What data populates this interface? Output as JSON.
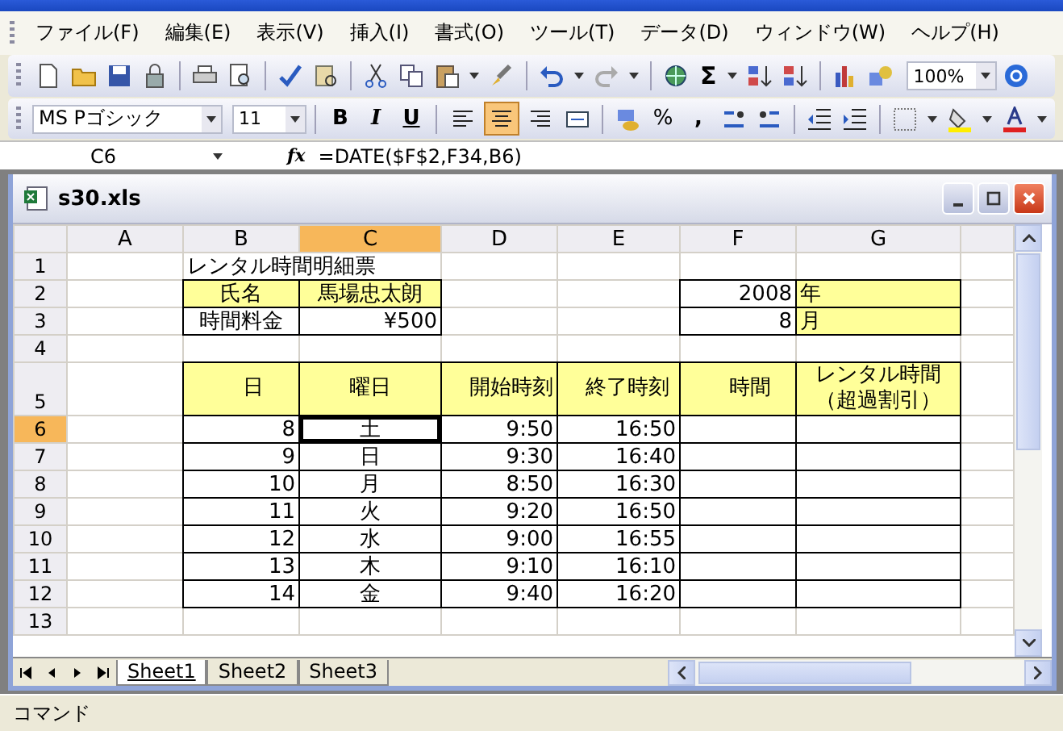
{
  "menu": [
    "ファイル(F)",
    "編集(E)",
    "表示(V)",
    "挿入(I)",
    "書式(O)",
    "ツール(T)",
    "データ(D)",
    "ウィンドウ(W)",
    "ヘルプ(H)"
  ],
  "standard_toolbar": {
    "sum_symbol": "Σ",
    "zoom": "100%"
  },
  "formatting_toolbar": {
    "font_name": "MS Pゴシック",
    "font_size": "11",
    "bold": "B",
    "italic": "I",
    "underline": "U",
    "alignment_buttons": [
      {
        "pressed": false
      },
      {
        "pressed": true
      },
      {
        "pressed": false
      }
    ],
    "percent": "%",
    "comma": ","
  },
  "formula_bar": {
    "name_box": "C6",
    "fx": "fx",
    "formula": "=DATE($F$2,F34,B6)"
  },
  "workbook": {
    "title": "s30.xls",
    "columns": [
      {
        "label": "A",
        "selected": false
      },
      {
        "label": "B",
        "selected": false
      },
      {
        "label": "C",
        "selected": true
      },
      {
        "label": "D",
        "selected": false
      },
      {
        "label": "E",
        "selected": false
      },
      {
        "label": "F",
        "selected": false
      },
      {
        "label": "G",
        "selected": false
      }
    ],
    "rows": [
      {
        "header": "1",
        "selected": false,
        "cells": [
          {
            "kind": "blank",
            "highlighted": false,
            "boxed": false
          },
          {
            "text": "レンタル時間明細票",
            "kind": "text",
            "colspan": 2,
            "highlighted": false,
            "boxed": false
          },
          {
            "kind": "blank",
            "highlighted": false,
            "boxed": false
          },
          {
            "kind": "blank",
            "highlighted": false,
            "boxed": false
          },
          {
            "kind": "blank",
            "highlighted": false,
            "boxed": false
          },
          {
            "kind": "blank",
            "highlighted": false,
            "boxed": false
          }
        ]
      },
      {
        "header": "2",
        "selected": false,
        "cells": [
          {
            "kind": "blank",
            "highlighted": false,
            "boxed": false
          },
          {
            "text": "氏名",
            "kind": "label",
            "highlighted": true,
            "boxed": true
          },
          {
            "text": "馬場忠太朗",
            "kind": "label",
            "highlighted": true,
            "boxed": true
          },
          {
            "kind": "blank",
            "highlighted": false,
            "boxed": false
          },
          {
            "kind": "blank",
            "highlighted": false,
            "boxed": false
          },
          {
            "text": "2008",
            "kind": "number",
            "highlighted": false,
            "boxed": true
          },
          {
            "text": "年",
            "kind": "text",
            "highlighted": true,
            "boxed": true
          }
        ]
      },
      {
        "header": "3",
        "selected": false,
        "cells": [
          {
            "kind": "blank",
            "highlighted": false,
            "boxed": false
          },
          {
            "text": "時間料金",
            "kind": "label",
            "highlighted": false,
            "boxed": true
          },
          {
            "text": "¥500",
            "kind": "number",
            "highlighted": false,
            "boxed": true
          },
          {
            "kind": "blank",
            "highlighted": false,
            "boxed": false
          },
          {
            "kind": "blank",
            "highlighted": false,
            "boxed": false
          },
          {
            "text": "8",
            "kind": "number",
            "highlighted": false,
            "boxed": true
          },
          {
            "text": "月",
            "kind": "text",
            "highlighted": true,
            "boxed": true
          }
        ]
      },
      {
        "header": "4",
        "selected": false,
        "cells": [
          {
            "kind": "blank",
            "highlighted": false,
            "boxed": false
          },
          {
            "kind": "blank",
            "highlighted": false,
            "boxed": false
          },
          {
            "kind": "blank",
            "highlighted": false,
            "boxed": false
          },
          {
            "kind": "blank",
            "highlighted": false,
            "boxed": false
          },
          {
            "kind": "blank",
            "highlighted": false,
            "boxed": false
          },
          {
            "kind": "blank",
            "highlighted": false,
            "boxed": false
          },
          {
            "kind": "blank",
            "highlighted": false,
            "boxed": false
          }
        ]
      },
      {
        "header": "5",
        "selected": false,
        "cells": [
          {
            "kind": "blank",
            "highlighted": false,
            "boxed": false
          },
          {
            "text": "日",
            "kind": "label",
            "highlighted": true,
            "boxed": true
          },
          {
            "text": "曜日",
            "kind": "label",
            "highlighted": true,
            "boxed": true
          },
          {
            "text": "開始時刻",
            "kind": "label",
            "highlighted": true,
            "boxed": true
          },
          {
            "text": "終了時刻",
            "kind": "label",
            "highlighted": true,
            "boxed": true
          },
          {
            "text": "時間",
            "kind": "label",
            "highlighted": true,
            "boxed": true
          },
          {
            "text": "レンタル時間（超過割引）",
            "kind": "label",
            "highlighted": true,
            "boxed": true
          }
        ]
      },
      {
        "header": "6",
        "selected": true,
        "cells": [
          {
            "kind": "blank",
            "highlighted": false,
            "boxed": false
          },
          {
            "text": "8",
            "kind": "number",
            "highlighted": false,
            "boxed": true
          },
          {
            "text": "土",
            "kind": "label",
            "highlighted": false,
            "boxed": true
          },
          {
            "text": "9:50",
            "kind": "number",
            "highlighted": false,
            "boxed": true
          },
          {
            "text": "16:50",
            "kind": "number",
            "highlighted": false,
            "boxed": true
          },
          {
            "kind": "blank",
            "highlighted": false,
            "boxed": true
          },
          {
            "kind": "blank",
            "highlighted": false,
            "boxed": true
          }
        ]
      },
      {
        "header": "7",
        "selected": false,
        "cells": [
          {
            "kind": "blank",
            "highlighted": false,
            "boxed": false
          },
          {
            "text": "9",
            "kind": "number",
            "highlighted": false,
            "boxed": true
          },
          {
            "text": "日",
            "kind": "label",
            "highlighted": false,
            "boxed": true
          },
          {
            "text": "9:30",
            "kind": "number",
            "highlighted": false,
            "boxed": true
          },
          {
            "text": "16:40",
            "kind": "number",
            "highlighted": false,
            "boxed": true
          },
          {
            "kind": "blank",
            "highlighted": false,
            "boxed": true
          },
          {
            "kind": "blank",
            "highlighted": false,
            "boxed": true
          }
        ]
      },
      {
        "header": "8",
        "selected": false,
        "cells": [
          {
            "kind": "blank",
            "highlighted": false,
            "boxed": false
          },
          {
            "text": "10",
            "kind": "number",
            "highlighted": false,
            "boxed": true
          },
          {
            "text": "月",
            "kind": "label",
            "highlighted": false,
            "boxed": true
          },
          {
            "text": "8:50",
            "kind": "number",
            "highlighted": false,
            "boxed": true
          },
          {
            "text": "16:30",
            "kind": "number",
            "highlighted": false,
            "boxed": true
          },
          {
            "kind": "blank",
            "highlighted": false,
            "boxed": true
          },
          {
            "kind": "blank",
            "highlighted": false,
            "boxed": true
          }
        ]
      },
      {
        "header": "9",
        "selected": false,
        "cells": [
          {
            "kind": "blank",
            "highlighted": false,
            "boxed": false
          },
          {
            "text": "11",
            "kind": "number",
            "highlighted": false,
            "boxed": true
          },
          {
            "text": "火",
            "kind": "label",
            "highlighted": false,
            "boxed": true
          },
          {
            "text": "9:20",
            "kind": "number",
            "highlighted": false,
            "boxed": true
          },
          {
            "text": "16:50",
            "kind": "number",
            "highlighted": false,
            "boxed": true
          },
          {
            "kind": "blank",
            "highlighted": false,
            "boxed": true
          },
          {
            "kind": "blank",
            "highlighted": false,
            "boxed": true
          }
        ]
      },
      {
        "header": "10",
        "selected": false,
        "cells": [
          {
            "kind": "blank",
            "highlighted": false,
            "boxed": false
          },
          {
            "text": "12",
            "kind": "number",
            "highlighted": false,
            "boxed": true
          },
          {
            "text": "水",
            "kind": "label",
            "highlighted": false,
            "boxed": true
          },
          {
            "text": "9:00",
            "kind": "number",
            "highlighted": false,
            "boxed": true
          },
          {
            "text": "16:55",
            "kind": "number",
            "highlighted": false,
            "boxed": true
          },
          {
            "kind": "blank",
            "highlighted": false,
            "boxed": true
          },
          {
            "kind": "blank",
            "highlighted": false,
            "boxed": true
          }
        ]
      },
      {
        "header": "11",
        "selected": false,
        "cells": [
          {
            "kind": "blank",
            "highlighted": false,
            "boxed": false
          },
          {
            "text": "13",
            "kind": "number",
            "highlighted": false,
            "boxed": true
          },
          {
            "text": "木",
            "kind": "label",
            "highlighted": false,
            "boxed": true
          },
          {
            "text": "9:10",
            "kind": "number",
            "highlighted": false,
            "boxed": true
          },
          {
            "text": "16:10",
            "kind": "number",
            "highlighted": false,
            "boxed": true
          },
          {
            "kind": "blank",
            "highlighted": false,
            "boxed": true
          },
          {
            "kind": "blank",
            "highlighted": false,
            "boxed": true
          }
        ]
      },
      {
        "header": "12",
        "selected": false,
        "cells": [
          {
            "kind": "blank",
            "highlighted": false,
            "boxed": false
          },
          {
            "text": "14",
            "kind": "number",
            "highlighted": false,
            "boxed": true
          },
          {
            "text": "金",
            "kind": "label",
            "highlighted": false,
            "boxed": true
          },
          {
            "text": "9:40",
            "kind": "number",
            "highlighted": false,
            "boxed": true
          },
          {
            "text": "16:20",
            "kind": "number",
            "highlighted": false,
            "boxed": true
          },
          {
            "kind": "blank",
            "highlighted": false,
            "boxed": true
          },
          {
            "kind": "blank",
            "highlighted": false,
            "boxed": true
          }
        ]
      },
      {
        "header": "13",
        "selected": false,
        "cells": [
          {
            "kind": "blank",
            "highlighted": false,
            "boxed": false
          },
          {
            "kind": "blank",
            "highlighted": false,
            "boxed": false
          },
          {
            "kind": "blank",
            "highlighted": false,
            "boxed": false
          },
          {
            "kind": "blank",
            "highlighted": false,
            "boxed": false
          },
          {
            "kind": "blank",
            "highlighted": false,
            "boxed": false
          },
          {
            "kind": "blank",
            "highlighted": false,
            "boxed": false
          },
          {
            "kind": "blank",
            "highlighted": false,
            "boxed": false
          }
        ]
      }
    ],
    "sheet_tabs": [
      {
        "label": "Sheet1",
        "selected": true
      },
      {
        "label": "Sheet2",
        "selected": false
      },
      {
        "label": "Sheet3",
        "selected": false
      }
    ]
  },
  "status_bar": "コマンド"
}
